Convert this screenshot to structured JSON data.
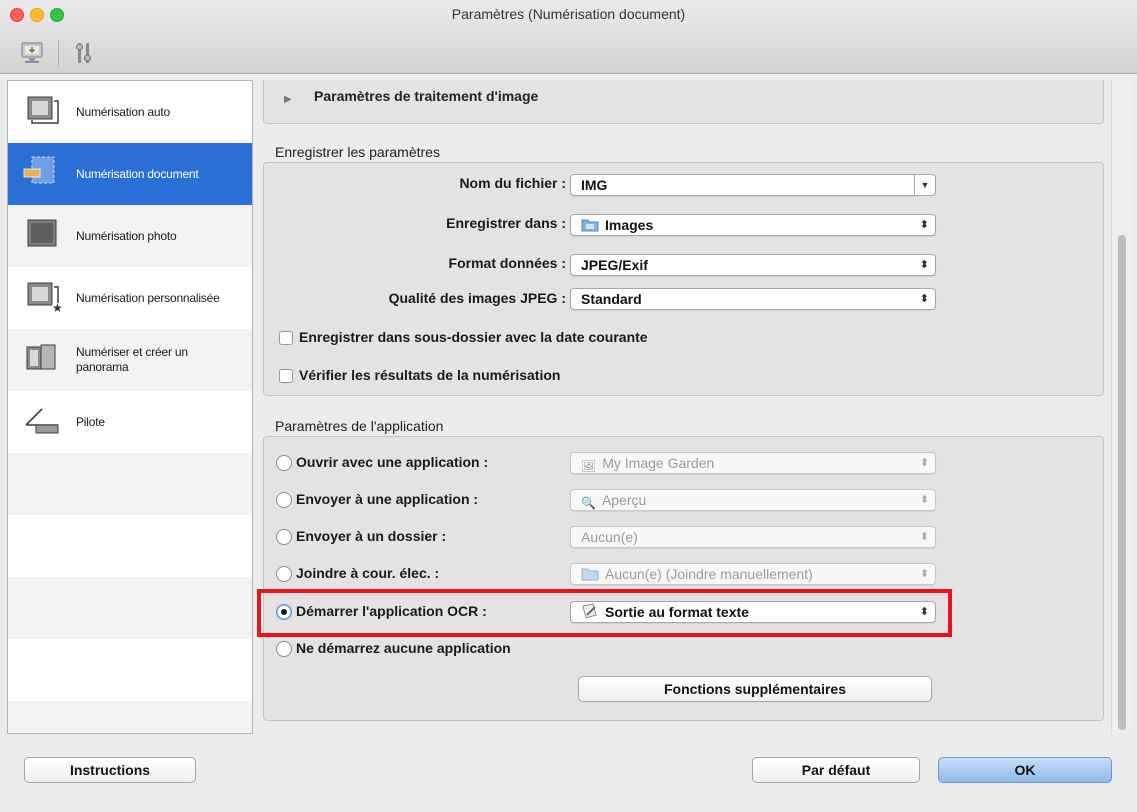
{
  "window": {
    "title": "Paramètres (Numérisation document)"
  },
  "sidebar": {
    "items": [
      {
        "label": "Numérisation auto"
      },
      {
        "label": "Numérisation document"
      },
      {
        "label": "Numérisation photo"
      },
      {
        "label": "Numérisation personnalisée"
      },
      {
        "label": "Numériser et créer un panorama"
      },
      {
        "label": "Pilote"
      }
    ]
  },
  "image_processing": {
    "title": "Paramètres de traitement d'image"
  },
  "save_settings": {
    "title": "Enregistrer les paramètres",
    "filename_label": "Nom du fichier :",
    "filename_value": "IMG",
    "save_in_label": "Enregistrer dans :",
    "save_in_value": "Images",
    "format_label": "Format données :",
    "format_value": "JPEG/Exif",
    "jpeg_quality_label": "Qualité des images JPEG :",
    "jpeg_quality_value": "Standard",
    "subfolder_checkbox": "Enregistrer dans sous-dossier avec la date courante",
    "check_results_checkbox": "Vérifier les résultats de la numérisation"
  },
  "app_settings": {
    "title": "Paramètres de l'application",
    "options": [
      {
        "label": "Ouvrir avec une application :",
        "value": "My Image Garden"
      },
      {
        "label": "Envoyer à une application :",
        "value": "Aperçu"
      },
      {
        "label": "Envoyer à un dossier :",
        "value": "Aucun(e)"
      },
      {
        "label": "Joindre à cour. élec. :",
        "value": "Aucun(e) (Joindre manuellement)"
      },
      {
        "label": "Démarrer l'application OCR :",
        "value": "Sortie au format texte"
      },
      {
        "label": "Ne démarrez aucune application"
      }
    ],
    "selected_index": 4,
    "more_functions": "Fonctions supplémentaires"
  },
  "footer": {
    "instructions": "Instructions",
    "defaults": "Par défaut",
    "ok": "OK"
  },
  "colors": {
    "selection": "#2a6fd6",
    "highlight": "#e8141c"
  }
}
